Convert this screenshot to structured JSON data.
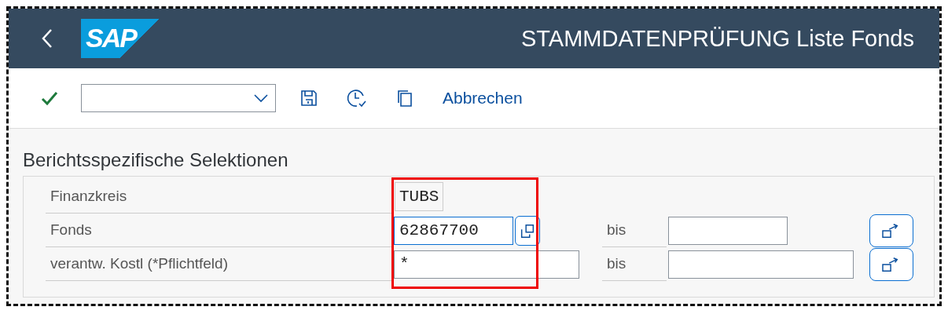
{
  "header": {
    "logo": "SAP",
    "title": "STAMMDATENPRÜFUNG Liste Fonds"
  },
  "toolbar": {
    "action": "Abbrechen"
  },
  "section": {
    "title": "Berichtsspezifische Selektionen",
    "rows": [
      {
        "kind": "display",
        "label": "Finanzkreis",
        "value": "TUBS"
      },
      {
        "kind": "range",
        "label": "Fonds",
        "value": "62867700",
        "focused": true,
        "to_label": "bis"
      },
      {
        "kind": "range",
        "label": "verantw. Kostl (*Pflichtfeld)",
        "value": "*",
        "focused": false,
        "to_label": "bis"
      }
    ]
  }
}
